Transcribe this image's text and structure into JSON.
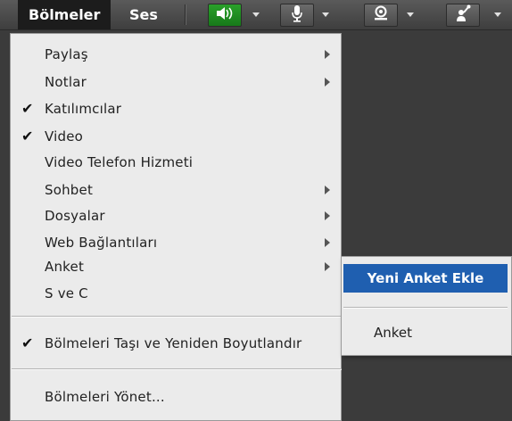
{
  "topbar": {
    "menus": [
      "Bölmeler",
      "Ses"
    ]
  },
  "icons": {
    "speaker": "speaker-icon",
    "microphone": "microphone-icon",
    "webcam": "webcam-icon",
    "raise_hand": "raise-hand-icon"
  },
  "colors": {
    "menu_bg": "#ebebeb",
    "highlight": "#1f5fb0",
    "topbar_bg": "#4a4a4a",
    "speaker_active": "#2aa12a"
  },
  "menu": {
    "items": [
      {
        "label": "Paylaş",
        "checked": false,
        "submenu": true
      },
      {
        "label": "Notlar",
        "checked": false,
        "submenu": true
      },
      {
        "label": "Katılımcılar",
        "checked": true,
        "submenu": false
      },
      {
        "label": "Video",
        "checked": true,
        "submenu": false
      },
      {
        "label": "Video Telefon Hizmeti",
        "checked": false,
        "submenu": false
      },
      {
        "label": "Sohbet",
        "checked": false,
        "submenu": true
      },
      {
        "label": "Dosyalar",
        "checked": false,
        "submenu": true
      },
      {
        "label": "Web Bağlantıları",
        "checked": false,
        "submenu": true
      },
      {
        "label": "Anket",
        "checked": false,
        "submenu": true
      },
      {
        "label": "S ve C",
        "checked": false,
        "submenu": false
      }
    ],
    "move_resize": {
      "label": "Bölmeleri Taşı ve Yeniden Boyutlandır",
      "checked": true
    },
    "manage": {
      "label": "Bölmeleri Yönet..."
    },
    "checkmark": "✔"
  },
  "submenu": {
    "add_poll": "Yeni Anket Ekle",
    "poll": "Anket"
  }
}
